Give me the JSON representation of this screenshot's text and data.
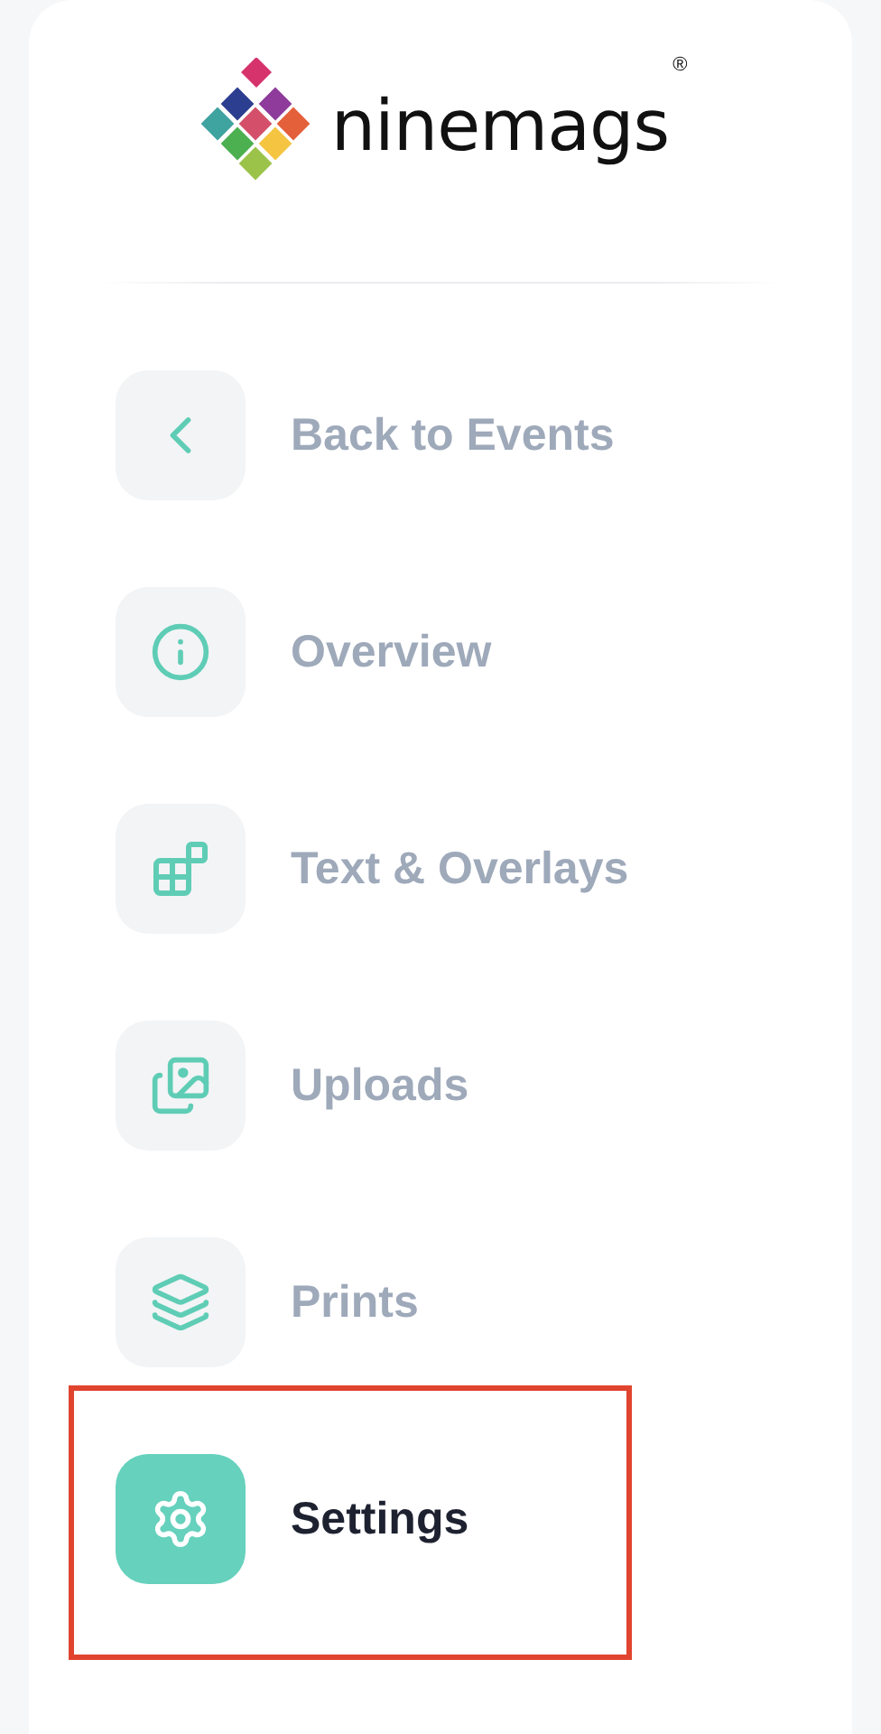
{
  "logo": {
    "wordmark": "ninemags",
    "registered": "®"
  },
  "nav": [
    {
      "kind": "back",
      "label": "Back to Events",
      "selected": false,
      "outlined": false
    },
    {
      "kind": "info",
      "label": "Overview",
      "selected": false,
      "outlined": false
    },
    {
      "kind": "blocks",
      "label": "Text & Overlays",
      "selected": false,
      "outlined": false
    },
    {
      "kind": "images",
      "label": "Uploads",
      "selected": false,
      "outlined": false
    },
    {
      "kind": "layers",
      "label": "Prints",
      "selected": false,
      "outlined": false
    },
    {
      "kind": "settings",
      "label": "Settings",
      "selected": true,
      "outlined": true
    }
  ]
}
